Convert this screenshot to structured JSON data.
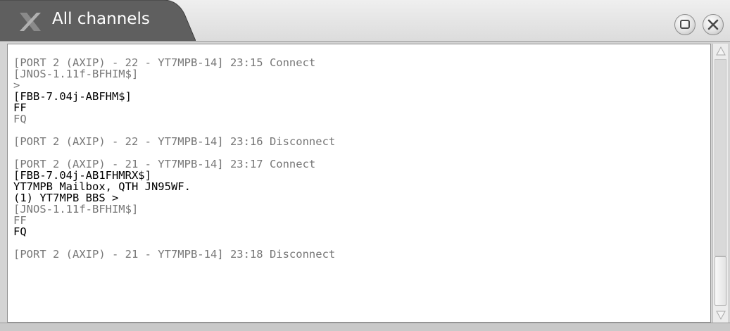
{
  "window": {
    "title": "All channels",
    "icons": {
      "app": "x-icon",
      "maximize": "maximize-icon",
      "close": "close-icon"
    },
    "colors": {
      "title_tab": "#5f5f5f",
      "title_text": "#ffffff",
      "content_bg": "#ffffff",
      "muted_text": "#777777"
    }
  },
  "log": {
    "lines": [
      {
        "text": "[PORT 2 (AXIP) - 22 - YT7MPB-14] 23:15 Connect",
        "style": "gray"
      },
      {
        "text": "[JNOS-1.11f-BFHIM$]",
        "style": "gray"
      },
      {
        "text": ">",
        "style": "gray"
      },
      {
        "text": "[FBB-7.04j-ABFHM$]",
        "style": "dark"
      },
      {
        "text": "FF",
        "style": "dark"
      },
      {
        "text": "FQ",
        "style": "gray"
      },
      {
        "text": "",
        "style": "gap"
      },
      {
        "text": "[PORT 2 (AXIP) - 22 - YT7MPB-14] 23:16 Disconnect",
        "style": "gray"
      },
      {
        "text": "",
        "style": "gap"
      },
      {
        "text": "[PORT 2 (AXIP) - 21 - YT7MPB-14] 23:17 Connect",
        "style": "gray"
      },
      {
        "text": "[FBB-7.04j-AB1FHMRX$]",
        "style": "dark"
      },
      {
        "text": "YT7MPB Mailbox, QTH JN95WF.",
        "style": "dark"
      },
      {
        "text": "(1) YT7MPB BBS >",
        "style": "dark"
      },
      {
        "text": "[JNOS-1.11f-BFHIM$]",
        "style": "gray"
      },
      {
        "text": "FF",
        "style": "gray"
      },
      {
        "text": "FQ",
        "style": "dark"
      },
      {
        "text": "",
        "style": "gap"
      },
      {
        "text": "[PORT 2 (AXIP) - 21 - YT7MPB-14] 23:18 Disconnect",
        "style": "gray"
      }
    ]
  }
}
